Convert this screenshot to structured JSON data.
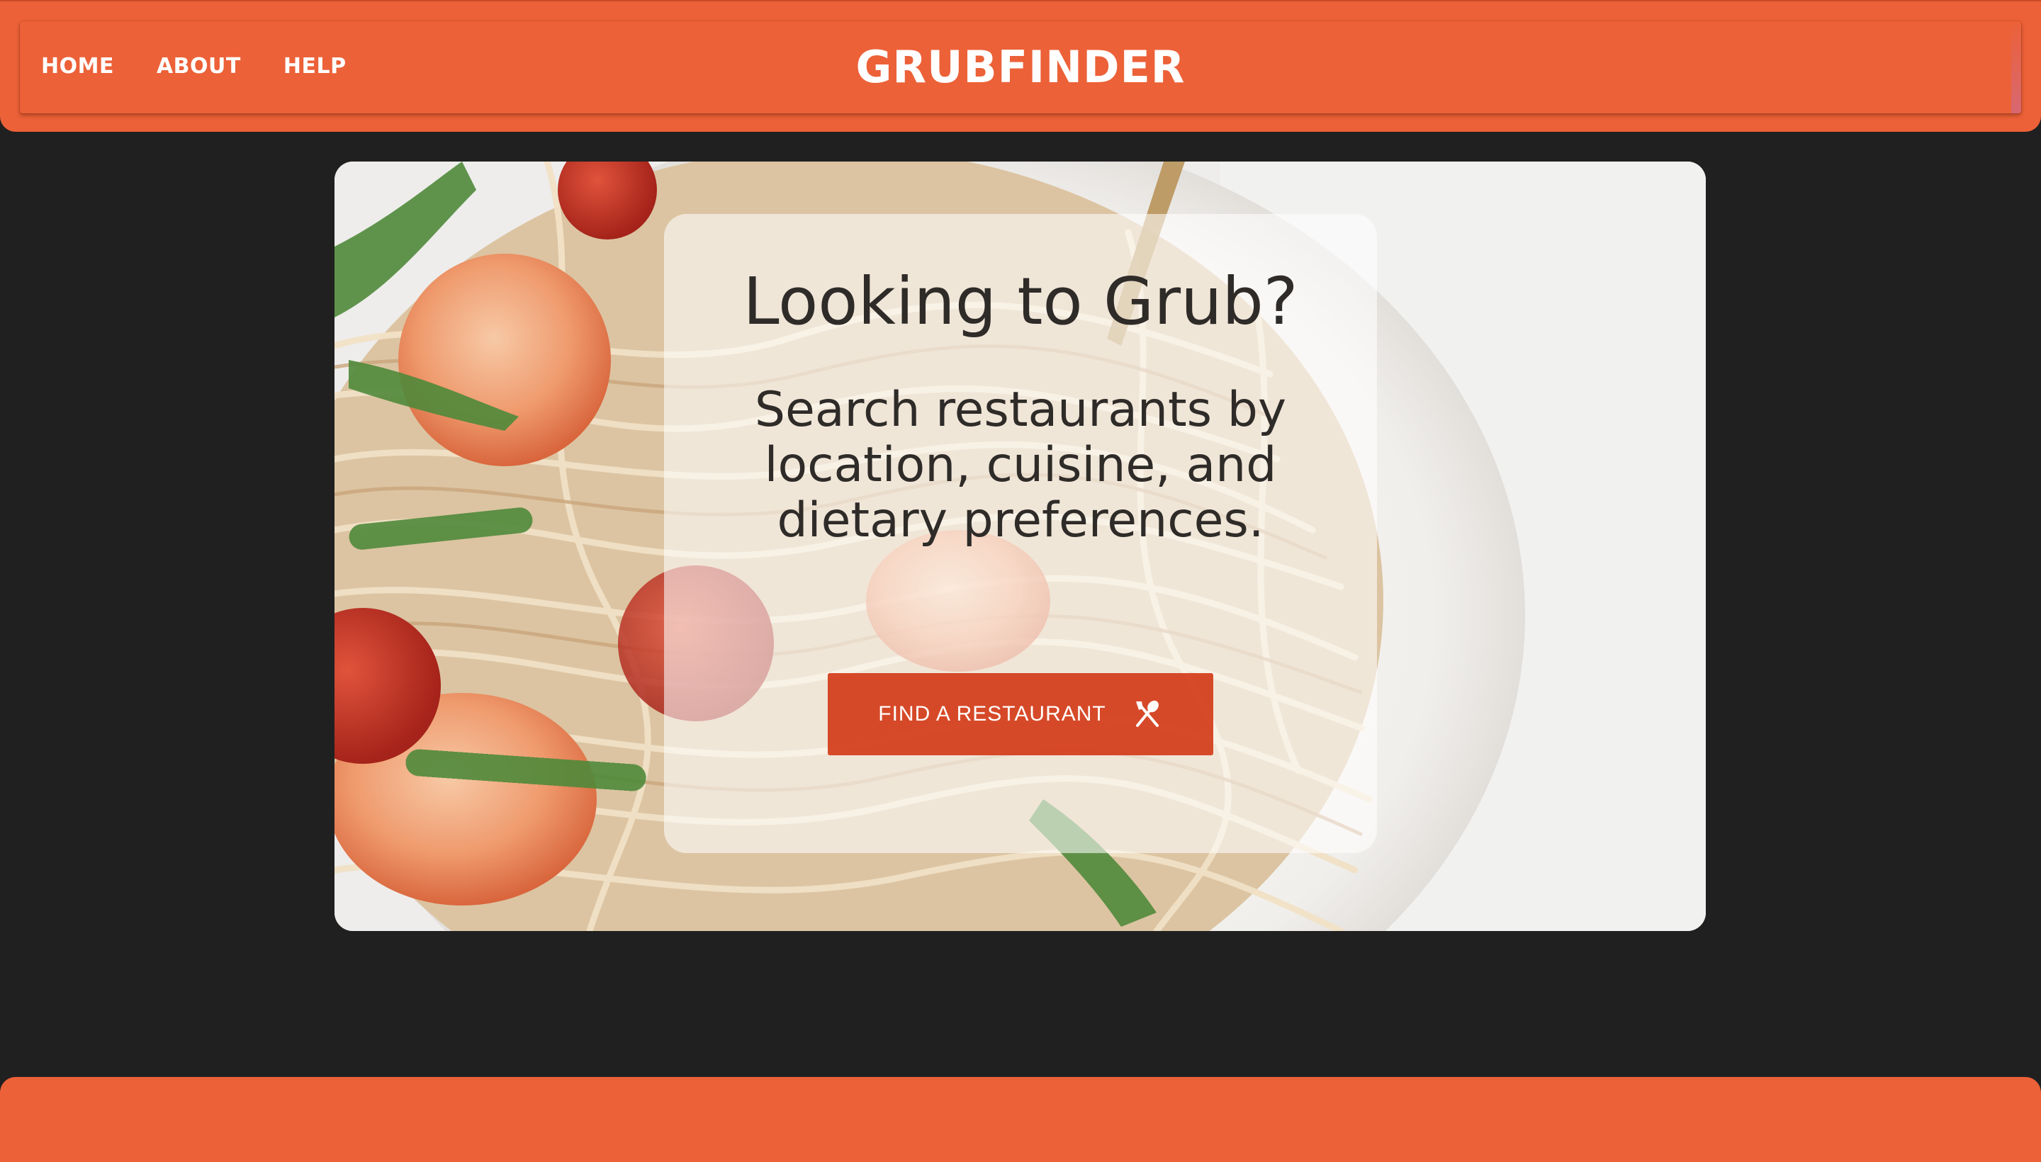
{
  "nav": {
    "items": [
      {
        "label": "HOME"
      },
      {
        "label": "ABOUT"
      },
      {
        "label": "HELP"
      }
    ]
  },
  "brand": {
    "title": "GRUBFINDER"
  },
  "hero": {
    "title": "Looking to Grub?",
    "subtitle": "Search restaurants by location, cuisine, and dietary preferences.",
    "cta_label": "FIND A RESTAURANT",
    "cta_icon": "fork-spoon-icon",
    "background_image": "shrimp-spaghetti-photo"
  },
  "colors": {
    "brand_orange": "#ec6138",
    "cta_red": "#d4401f",
    "page_background": "#202020",
    "text_dark": "#2e2b28"
  }
}
